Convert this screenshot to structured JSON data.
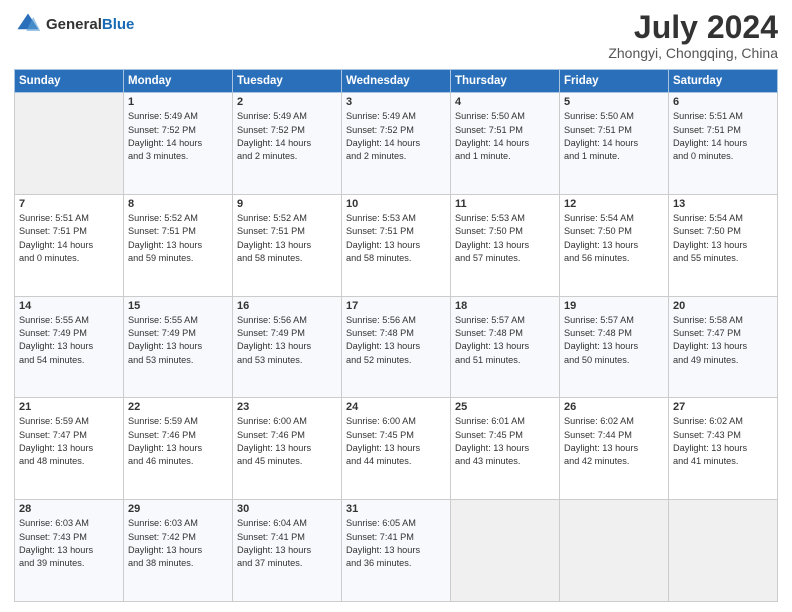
{
  "logo": {
    "general": "General",
    "blue": "Blue"
  },
  "title": {
    "month_year": "July 2024",
    "location": "Zhongyi, Chongqing, China"
  },
  "weekdays": [
    "Sunday",
    "Monday",
    "Tuesday",
    "Wednesday",
    "Thursday",
    "Friday",
    "Saturday"
  ],
  "weeks": [
    [
      {
        "day": "",
        "info": ""
      },
      {
        "day": "1",
        "info": "Sunrise: 5:49 AM\nSunset: 7:52 PM\nDaylight: 14 hours\nand 3 minutes."
      },
      {
        "day": "2",
        "info": "Sunrise: 5:49 AM\nSunset: 7:52 PM\nDaylight: 14 hours\nand 2 minutes."
      },
      {
        "day": "3",
        "info": "Sunrise: 5:49 AM\nSunset: 7:52 PM\nDaylight: 14 hours\nand 2 minutes."
      },
      {
        "day": "4",
        "info": "Sunrise: 5:50 AM\nSunset: 7:51 PM\nDaylight: 14 hours\nand 1 minute."
      },
      {
        "day": "5",
        "info": "Sunrise: 5:50 AM\nSunset: 7:51 PM\nDaylight: 14 hours\nand 1 minute."
      },
      {
        "day": "6",
        "info": "Sunrise: 5:51 AM\nSunset: 7:51 PM\nDaylight: 14 hours\nand 0 minutes."
      }
    ],
    [
      {
        "day": "7",
        "info": "Sunrise: 5:51 AM\nSunset: 7:51 PM\nDaylight: 14 hours\nand 0 minutes."
      },
      {
        "day": "8",
        "info": "Sunrise: 5:52 AM\nSunset: 7:51 PM\nDaylight: 13 hours\nand 59 minutes."
      },
      {
        "day": "9",
        "info": "Sunrise: 5:52 AM\nSunset: 7:51 PM\nDaylight: 13 hours\nand 58 minutes."
      },
      {
        "day": "10",
        "info": "Sunrise: 5:53 AM\nSunset: 7:51 PM\nDaylight: 13 hours\nand 58 minutes."
      },
      {
        "day": "11",
        "info": "Sunrise: 5:53 AM\nSunset: 7:50 PM\nDaylight: 13 hours\nand 57 minutes."
      },
      {
        "day": "12",
        "info": "Sunrise: 5:54 AM\nSunset: 7:50 PM\nDaylight: 13 hours\nand 56 minutes."
      },
      {
        "day": "13",
        "info": "Sunrise: 5:54 AM\nSunset: 7:50 PM\nDaylight: 13 hours\nand 55 minutes."
      }
    ],
    [
      {
        "day": "14",
        "info": "Sunrise: 5:55 AM\nSunset: 7:49 PM\nDaylight: 13 hours\nand 54 minutes."
      },
      {
        "day": "15",
        "info": "Sunrise: 5:55 AM\nSunset: 7:49 PM\nDaylight: 13 hours\nand 53 minutes."
      },
      {
        "day": "16",
        "info": "Sunrise: 5:56 AM\nSunset: 7:49 PM\nDaylight: 13 hours\nand 53 minutes."
      },
      {
        "day": "17",
        "info": "Sunrise: 5:56 AM\nSunset: 7:48 PM\nDaylight: 13 hours\nand 52 minutes."
      },
      {
        "day": "18",
        "info": "Sunrise: 5:57 AM\nSunset: 7:48 PM\nDaylight: 13 hours\nand 51 minutes."
      },
      {
        "day": "19",
        "info": "Sunrise: 5:57 AM\nSunset: 7:48 PM\nDaylight: 13 hours\nand 50 minutes."
      },
      {
        "day": "20",
        "info": "Sunrise: 5:58 AM\nSunset: 7:47 PM\nDaylight: 13 hours\nand 49 minutes."
      }
    ],
    [
      {
        "day": "21",
        "info": "Sunrise: 5:59 AM\nSunset: 7:47 PM\nDaylight: 13 hours\nand 48 minutes."
      },
      {
        "day": "22",
        "info": "Sunrise: 5:59 AM\nSunset: 7:46 PM\nDaylight: 13 hours\nand 46 minutes."
      },
      {
        "day": "23",
        "info": "Sunrise: 6:00 AM\nSunset: 7:46 PM\nDaylight: 13 hours\nand 45 minutes."
      },
      {
        "day": "24",
        "info": "Sunrise: 6:00 AM\nSunset: 7:45 PM\nDaylight: 13 hours\nand 44 minutes."
      },
      {
        "day": "25",
        "info": "Sunrise: 6:01 AM\nSunset: 7:45 PM\nDaylight: 13 hours\nand 43 minutes."
      },
      {
        "day": "26",
        "info": "Sunrise: 6:02 AM\nSunset: 7:44 PM\nDaylight: 13 hours\nand 42 minutes."
      },
      {
        "day": "27",
        "info": "Sunrise: 6:02 AM\nSunset: 7:43 PM\nDaylight: 13 hours\nand 41 minutes."
      }
    ],
    [
      {
        "day": "28",
        "info": "Sunrise: 6:03 AM\nSunset: 7:43 PM\nDaylight: 13 hours\nand 39 minutes."
      },
      {
        "day": "29",
        "info": "Sunrise: 6:03 AM\nSunset: 7:42 PM\nDaylight: 13 hours\nand 38 minutes."
      },
      {
        "day": "30",
        "info": "Sunrise: 6:04 AM\nSunset: 7:41 PM\nDaylight: 13 hours\nand 37 minutes."
      },
      {
        "day": "31",
        "info": "Sunrise: 6:05 AM\nSunset: 7:41 PM\nDaylight: 13 hours\nand 36 minutes."
      },
      {
        "day": "",
        "info": ""
      },
      {
        "day": "",
        "info": ""
      },
      {
        "day": "",
        "info": ""
      }
    ]
  ]
}
